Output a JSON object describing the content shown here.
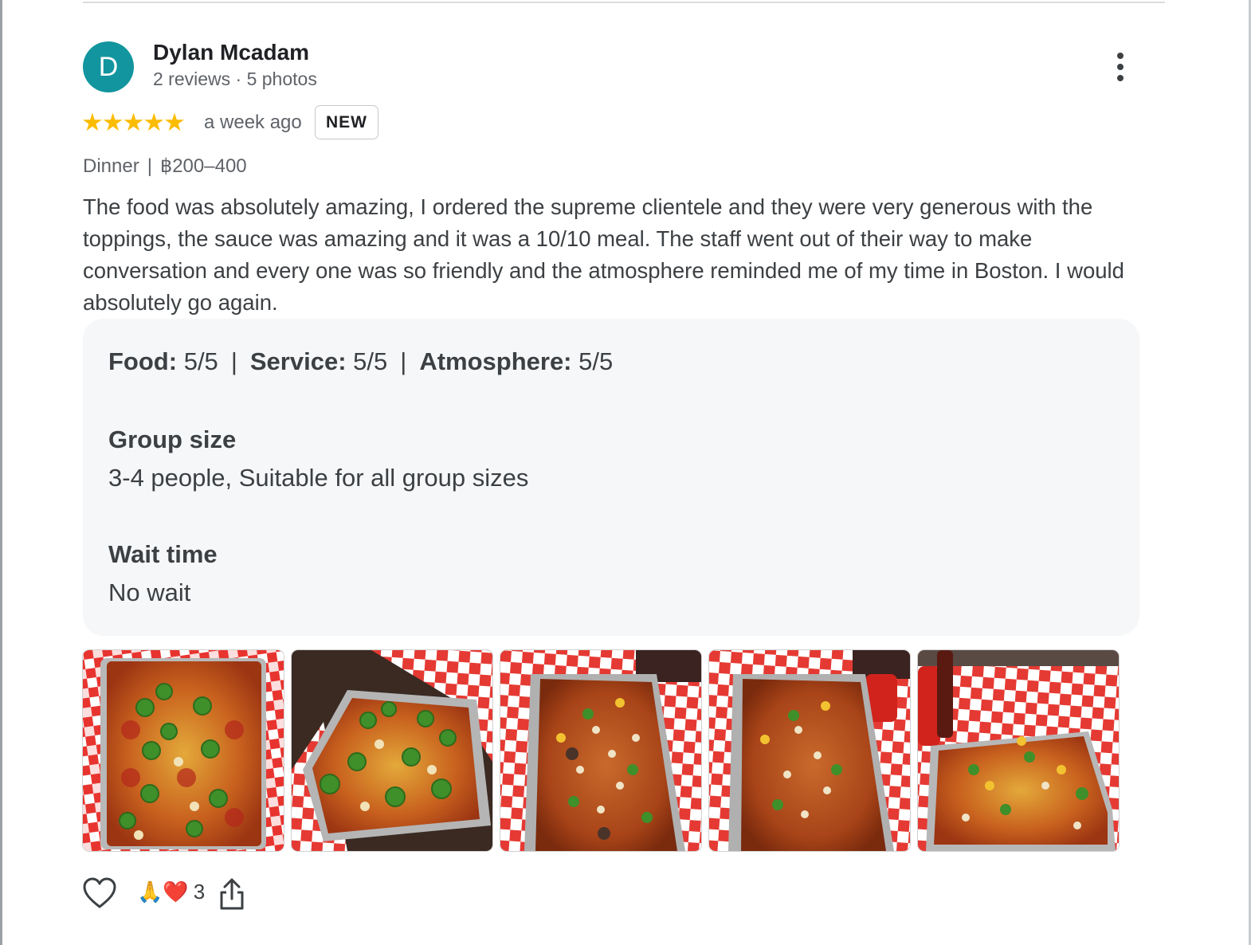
{
  "review": {
    "avatar_letter": "D",
    "author": "Dylan Mcadam",
    "author_meta": "2 reviews · 5 photos",
    "stars": "★★★★★",
    "rating": 5,
    "time": "a week ago",
    "badge": "NEW",
    "meal": "Dinner",
    "tag_separator": "|",
    "price": "฿200–400",
    "text": "The food was absolutely amazing, I ordered the supreme clientele and they were very generous with the toppings, the sauce was amazing and it was a 10/10 meal. The staff went out of their way to make conversation and every one was so friendly and the atmosphere reminded me of my time in Boston. I would absolutely go again."
  },
  "details": {
    "ratings": [
      {
        "label": "Food:",
        "value": "5/5"
      },
      {
        "label": "Service:",
        "value": "5/5"
      },
      {
        "label": "Atmosphere:",
        "value": "5/5"
      }
    ],
    "separator": "|",
    "group_size": {
      "title": "Group size",
      "value": "3-4 people, Suitable for all group sizes"
    },
    "wait_time": {
      "title": "Wait time",
      "value": "No wait"
    }
  },
  "photos": [
    "pizza-photo-1",
    "pizza-photo-2",
    "pizza-photo-3",
    "pizza-photo-4",
    "pizza-photo-5"
  ],
  "actions": {
    "like_icon": "heart-outline-icon",
    "reactions": "🙏❤️",
    "reaction_count": "3",
    "share_icon": "share-icon"
  },
  "colors": {
    "avatar": "#12959e",
    "star": "#fbbc04",
    "details_bg": "#f6f7f9",
    "tablecloth_red": "#e8342f"
  }
}
